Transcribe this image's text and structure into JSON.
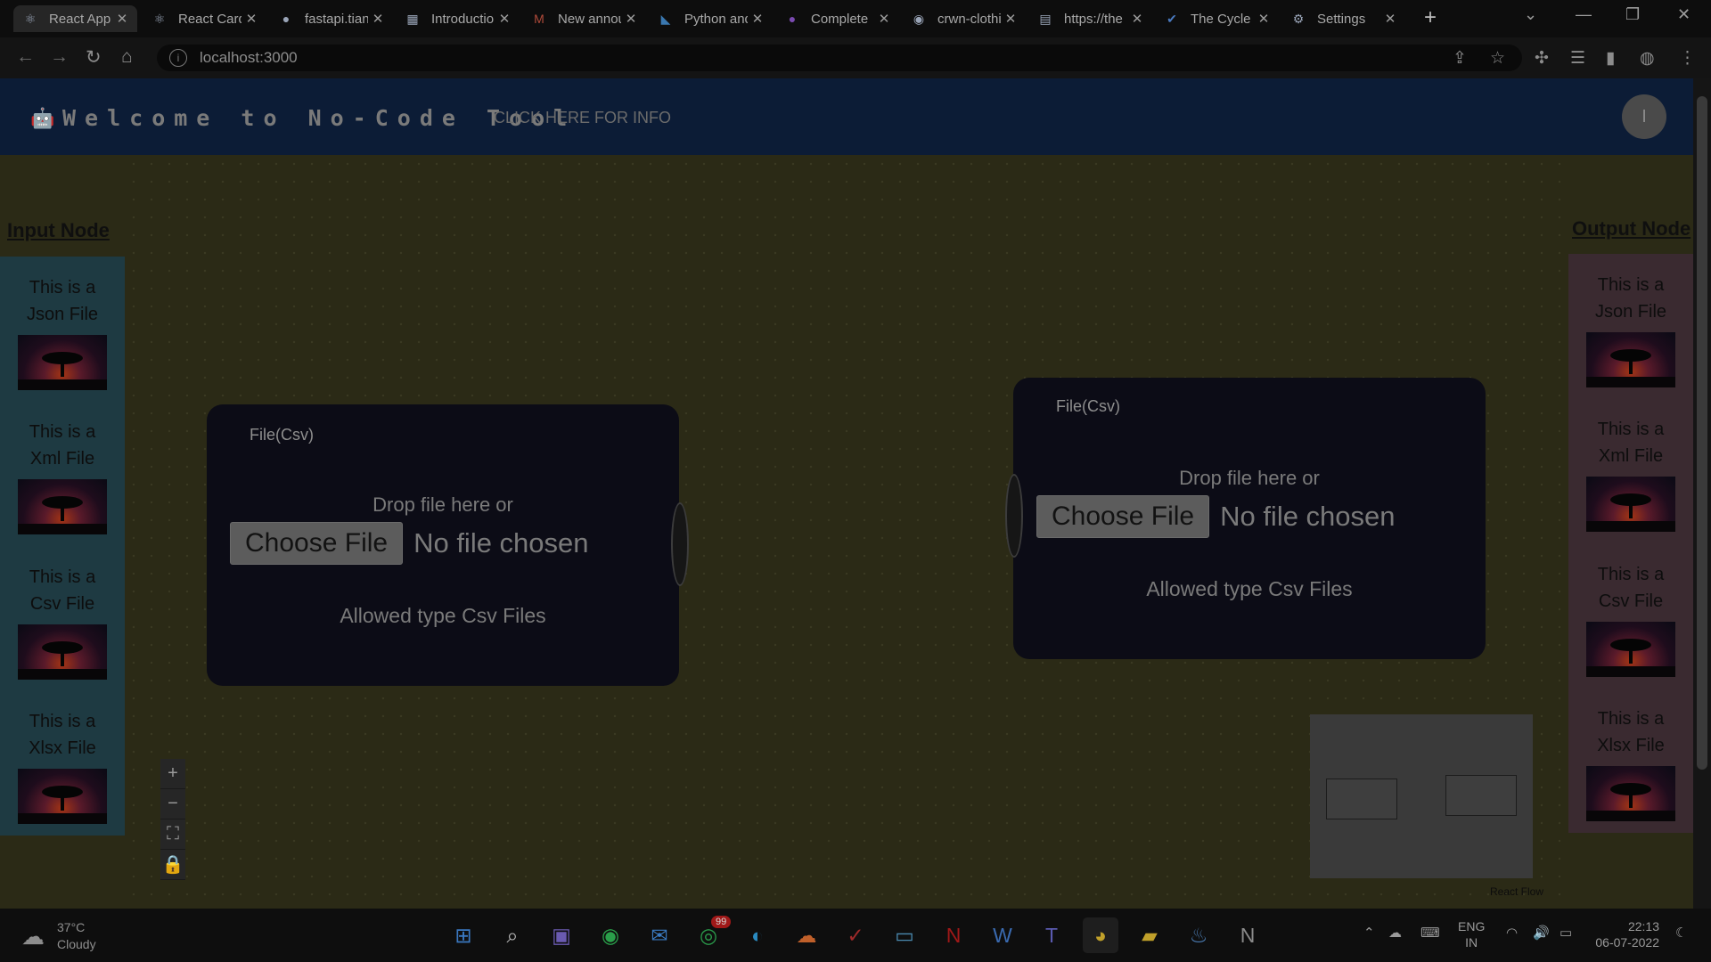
{
  "browser": {
    "tabs": [
      {
        "title": "React App",
        "favicon": "react-icon",
        "active": true
      },
      {
        "title": "React Card",
        "favicon": "react-icon"
      },
      {
        "title": "fastapi.tiangolo.com",
        "favicon": "fastapi-icon"
      },
      {
        "title": "Introduction",
        "favicon": "grid-icon"
      },
      {
        "title": "New announcement",
        "favicon": "gmail-icon"
      },
      {
        "title": "Python and",
        "favicon": "vscode-icon"
      },
      {
        "title": "Complete",
        "favicon": "purple-circle-icon"
      },
      {
        "title": "crwn-clothing",
        "favicon": "github-icon"
      },
      {
        "title": "https://the",
        "favicon": "page-icon"
      },
      {
        "title": "The Cycle",
        "favicon": "check-icon"
      },
      {
        "title": "Settings",
        "favicon": "gear-icon"
      }
    ],
    "url": "localhost:3000"
  },
  "header": {
    "title": "Welcome to No-Code Tool",
    "info_link": "CLICK HERE FOR INFO",
    "avatar_letter": "I"
  },
  "input_sidebar": {
    "title": "Input Node",
    "items": [
      {
        "label_line1": "This is a",
        "label_line2": "Json File"
      },
      {
        "label_line1": "This is a",
        "label_line2": "Xml File"
      },
      {
        "label_line1": "This is a",
        "label_line2": "Csv File"
      },
      {
        "label_line1": "This is a",
        "label_line2": "Xlsx File"
      }
    ]
  },
  "output_sidebar": {
    "title": "Output Node",
    "items": [
      {
        "label_line1": "This is a",
        "label_line2": "Json File"
      },
      {
        "label_line1": "This is a",
        "label_line2": "Xml File"
      },
      {
        "label_line1": "This is a",
        "label_line2": "Csv File"
      },
      {
        "label_line1": "This is a",
        "label_line2": "Xlsx File"
      }
    ]
  },
  "nodes": [
    {
      "title": "File(Csv)",
      "drop_text": "Drop file here or",
      "choose_label": "Choose File",
      "no_file": "No file chosen",
      "allowed": "Allowed type Csv Files"
    },
    {
      "title": "File(Csv)",
      "drop_text": "Drop file here or",
      "choose_label": "Choose File",
      "no_file": "No file chosen",
      "allowed": "Allowed type Csv Files"
    }
  ],
  "flow_controls": {
    "zoom_in": "+",
    "zoom_out": "−",
    "fit_view": "⛶",
    "lock": "🔒"
  },
  "attribution": "React Flow",
  "taskbar": {
    "weather_temp": "37°C",
    "weather_cond": "Cloudy",
    "whatsapp_badge": "99",
    "lang_line1": "ENG",
    "lang_line2": "IN",
    "time": "22:13",
    "date": "06-07-2022"
  }
}
